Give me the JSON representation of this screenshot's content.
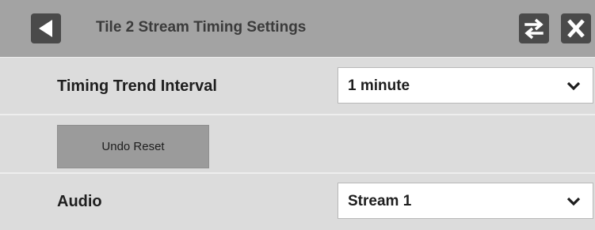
{
  "title_bar": {
    "title": "Tile 2 Stream Timing Settings",
    "back_icon": "back-triangle-icon",
    "swap_icon": "swap-arrows-icon",
    "close_icon": "close-x-icon"
  },
  "settings": {
    "timing_trend_interval": {
      "label": "Timing Trend Interval",
      "value": "1 minute"
    },
    "undo_reset": {
      "label": "Undo Reset"
    },
    "audio": {
      "label": "Audio",
      "value": "Stream 1"
    }
  },
  "colors": {
    "titlebar_bg": "#a3a3a3",
    "panel_bg": "#dcdcdc",
    "icon_bg": "#4a4a4a",
    "button_bg": "#9b9b9b"
  }
}
